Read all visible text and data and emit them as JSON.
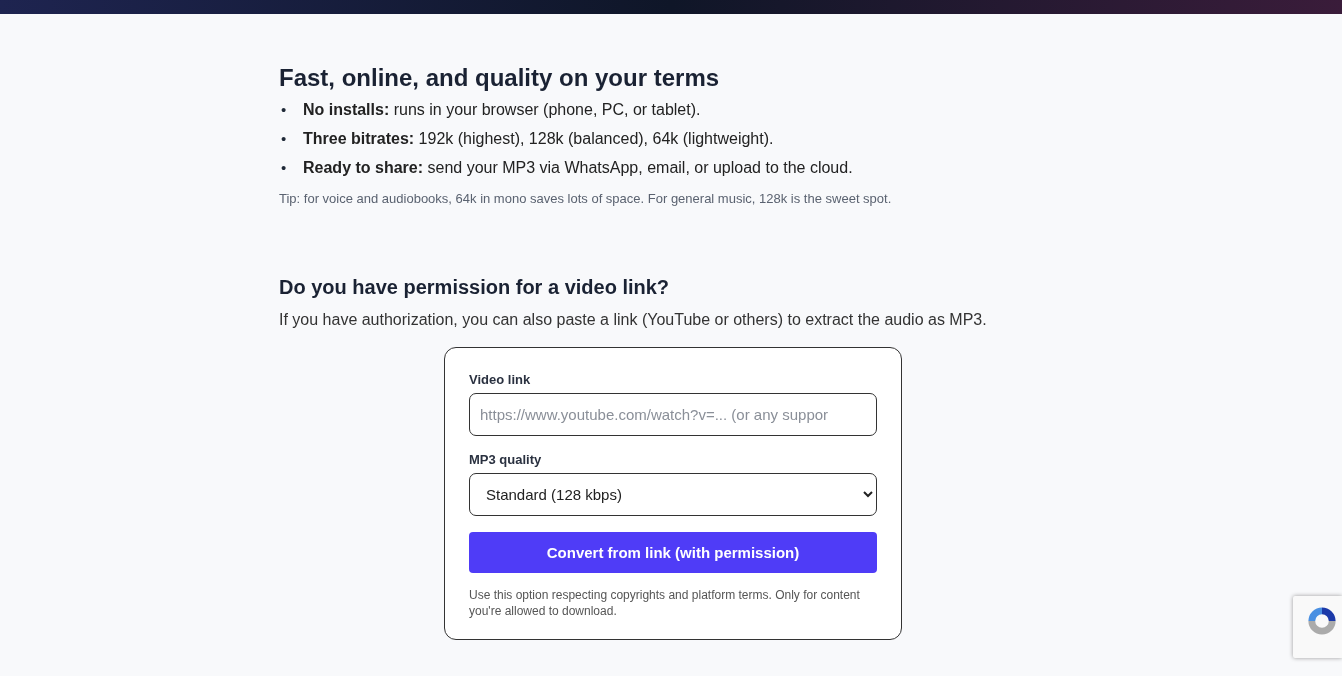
{
  "features": {
    "heading": "Fast, online, and quality on your terms",
    "bullets": [
      {
        "marker": "•",
        "text": "**No installs:** runs in your browser (phone, PC, or tablet)."
      },
      {
        "marker": "•",
        "text": "**Three bitrates:** 192k (highest), 128k (balanced), 64k (lightweight)."
      },
      {
        "marker": "•",
        "text": "**Ready to share:** send your MP3 via WhatsApp, email, or upload to the cloud."
      }
    ],
    "tip": "Tip: for voice and audiobooks, 64k in mono saves lots of space. For general music, 128k is the sweet spot."
  },
  "permission": {
    "heading": "Do you have permission for a video link?",
    "intro": "If you have authorization, you can also paste a link (YouTube or others) to extract the audio as MP3.",
    "form": {
      "link_label": "Video link",
      "link_placeholder": "https://www.youtube.com/watch?v=... (or any suppor",
      "quality_label": "MP3 quality",
      "quality_value": "Standard (128 kbps)",
      "button": "Convert from link (with permission)",
      "note": "Use this option respecting copyrights and platform terms. Only for content you're allowed to download."
    }
  }
}
